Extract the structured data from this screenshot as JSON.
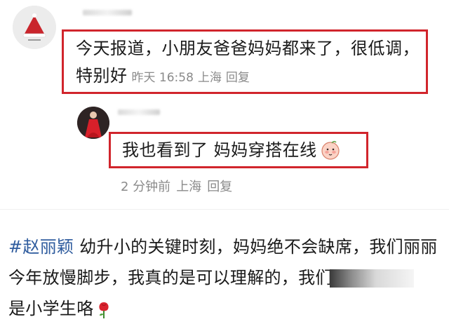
{
  "comment": {
    "text": "今天报道，小朋友爸爸妈妈都来了，很低调，特别好",
    "time": "昨天 16:58",
    "location": "上海",
    "reply_label": "回复"
  },
  "reply": {
    "text": "我也看到了 妈妈穿搭在线",
    "time": "2 分钟前",
    "location": "上海",
    "reply_label": "回复"
  },
  "post": {
    "hashtag": "#赵丽颖",
    "text_part1": " 幼升小的关键时刻，妈妈绝不会缺席，我们丽丽今年放慢脚步，我真的是可以理解的，我们",
    "text_part2": "是小学生咯"
  },
  "colors": {
    "highlight_border": "#d1252c",
    "hashtag": "#2f5c9e",
    "meta_gray": "#8a8a8a"
  },
  "icons": {
    "commenter_avatar": "santa-hat-avatar-icon",
    "reply_avatar": "red-dress-avatar-icon",
    "emoji": "blushing-peach-emoji-icon",
    "rose": "rose-emoji-icon"
  }
}
